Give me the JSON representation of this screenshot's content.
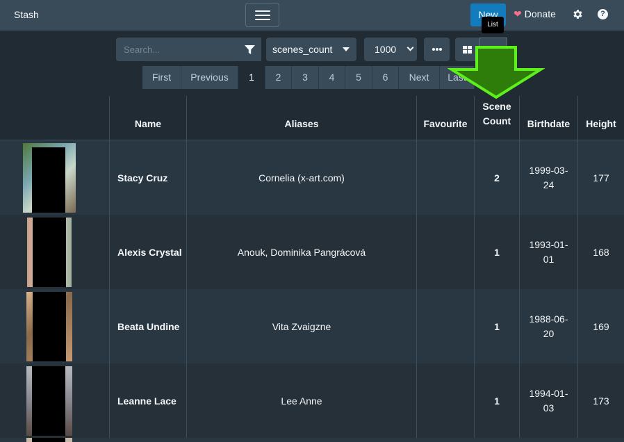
{
  "navbar": {
    "brand": "Stash",
    "new_label": "New",
    "donate_label": "Donate",
    "tooltip": "List"
  },
  "toolbar": {
    "search_placeholder": "Search...",
    "sort_value": "scenes_count",
    "per_page_value": "1000"
  },
  "pagination": [
    "First",
    "Previous",
    "1",
    "2",
    "3",
    "4",
    "5",
    "6",
    "Next",
    "Last"
  ],
  "pagination_active": "1",
  "table": {
    "headers": {
      "name": "Name",
      "aliases": "Aliases",
      "favourite": "Favourite",
      "scene_count_line1": "Scene",
      "scene_count_line2": "Count",
      "birthdate": "Birthdate",
      "height": "Height"
    },
    "rows": [
      {
        "name": "Stacy Cruz",
        "aliases": "Cornelia (x-art.com)",
        "favourite": "",
        "scene_count": "2",
        "birthdate_a": "1999-03-",
        "birthdate_b": "24",
        "height": "177"
      },
      {
        "name": "Alexis Crystal",
        "aliases": "Anouk, Dominika Pangrácová",
        "favourite": "",
        "scene_count": "1",
        "birthdate_a": "1993-01-",
        "birthdate_b": "01",
        "height": "168"
      },
      {
        "name": "Beata Undine",
        "aliases": "Vita Zvaigzne",
        "favourite": "",
        "scene_count": "1",
        "birthdate_a": "1988-06-",
        "birthdate_b": "20",
        "height": "169"
      },
      {
        "name": "Leanne Lace",
        "aliases": "Lee Anne",
        "favourite": "",
        "scene_count": "1",
        "birthdate_a": "1994-01-",
        "birthdate_b": "03",
        "height": "173"
      }
    ]
  },
  "colors": {
    "navbar": "#394b59",
    "background": "#202b33",
    "primary": "#137cbd",
    "arrow": "#2e7d0a",
    "arrow_outline": "#5ef01a"
  },
  "icons": [
    "hamburger-icon",
    "heart-icon",
    "gear-icon",
    "help-icon",
    "filter-icon",
    "caret-down-icon",
    "chevron-down-icon",
    "ellipsis-icon",
    "grid-icon",
    "down-arrow-overlay"
  ]
}
